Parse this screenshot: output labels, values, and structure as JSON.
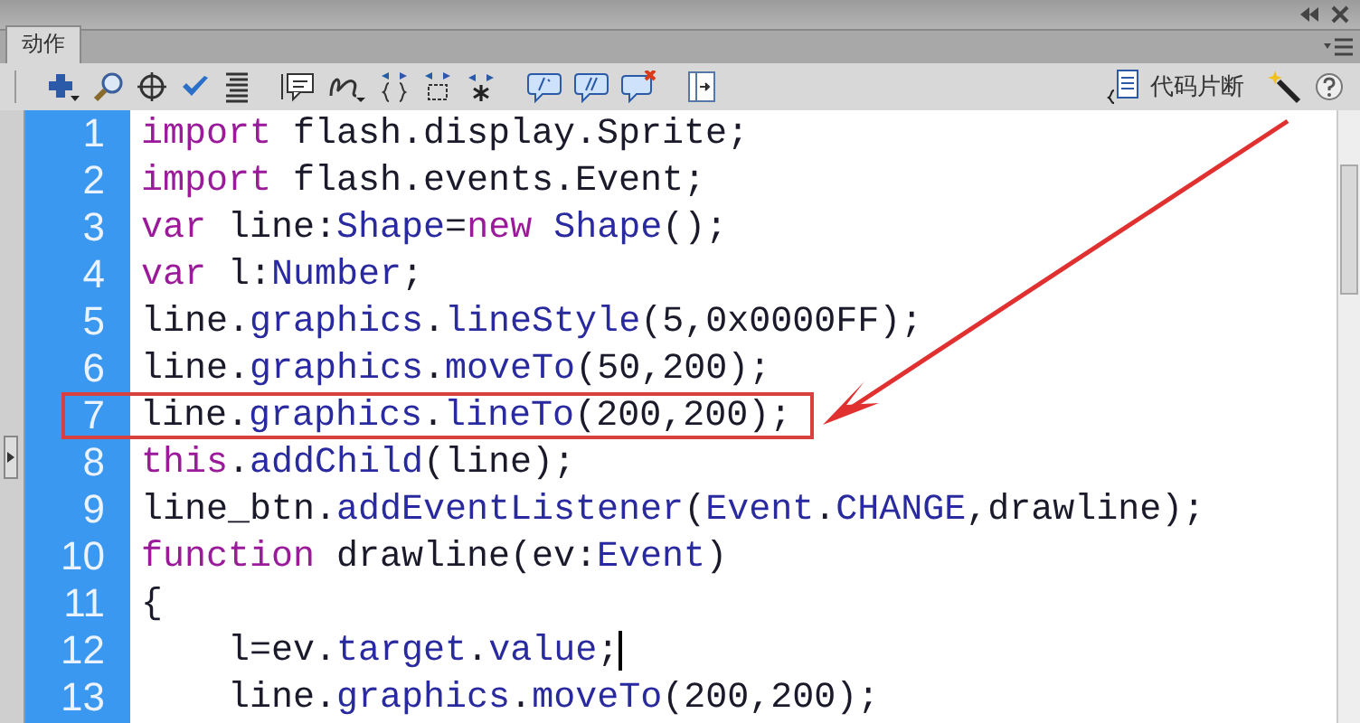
{
  "tabs": [
    {
      "label": "动作",
      "selected": true
    }
  ],
  "toolbar": {
    "snippets_label": "代码片断"
  },
  "lines": [
    {
      "number": "1",
      "highlighted": false,
      "cursor": false,
      "tokens": [
        {
          "kind": "kw",
          "text": "import"
        },
        {
          "kind": "plain",
          "text": " flash.display.Sprite;"
        }
      ]
    },
    {
      "number": "2",
      "highlighted": false,
      "cursor": false,
      "tokens": [
        {
          "kind": "kw",
          "text": "import"
        },
        {
          "kind": "plain",
          "text": " flash.events.Event;"
        }
      ]
    },
    {
      "number": "3",
      "highlighted": false,
      "cursor": false,
      "tokens": [
        {
          "kind": "kw",
          "text": "var"
        },
        {
          "kind": "plain",
          "text": " line:"
        },
        {
          "kind": "api",
          "text": "Shape"
        },
        {
          "kind": "plain",
          "text": "="
        },
        {
          "kind": "kw",
          "text": "new"
        },
        {
          "kind": "api",
          "text": " Shape"
        },
        {
          "kind": "plain",
          "text": "();"
        }
      ]
    },
    {
      "number": "4",
      "highlighted": false,
      "cursor": false,
      "tokens": [
        {
          "kind": "kw",
          "text": "var"
        },
        {
          "kind": "plain",
          "text": " l:"
        },
        {
          "kind": "api",
          "text": "Number"
        },
        {
          "kind": "plain",
          "text": ";"
        }
      ]
    },
    {
      "number": "5",
      "highlighted": false,
      "cursor": false,
      "tokens": [
        {
          "kind": "plain",
          "text": "line."
        },
        {
          "kind": "api",
          "text": "graphics"
        },
        {
          "kind": "plain",
          "text": "."
        },
        {
          "kind": "api",
          "text": "lineStyle"
        },
        {
          "kind": "plain",
          "text": "(5,0x0000FF);"
        }
      ]
    },
    {
      "number": "6",
      "highlighted": false,
      "cursor": false,
      "tokens": [
        {
          "kind": "plain",
          "text": "line."
        },
        {
          "kind": "api",
          "text": "graphics"
        },
        {
          "kind": "plain",
          "text": "."
        },
        {
          "kind": "api",
          "text": "moveTo"
        },
        {
          "kind": "plain",
          "text": "(50,200);"
        }
      ]
    },
    {
      "number": "7",
      "highlighted": true,
      "cursor": false,
      "tokens": [
        {
          "kind": "plain",
          "text": "line."
        },
        {
          "kind": "api",
          "text": "graphics"
        },
        {
          "kind": "plain",
          "text": "."
        },
        {
          "kind": "api",
          "text": "lineTo"
        },
        {
          "kind": "plain",
          "text": "(200,200);"
        }
      ]
    },
    {
      "number": "8",
      "highlighted": false,
      "cursor": false,
      "tokens": [
        {
          "kind": "kw",
          "text": "this"
        },
        {
          "kind": "plain",
          "text": "."
        },
        {
          "kind": "api",
          "text": "addChild"
        },
        {
          "kind": "plain",
          "text": "(line);"
        }
      ]
    },
    {
      "number": "9",
      "highlighted": false,
      "cursor": false,
      "tokens": [
        {
          "kind": "plain",
          "text": "line_btn."
        },
        {
          "kind": "api",
          "text": "addEventListener"
        },
        {
          "kind": "plain",
          "text": "("
        },
        {
          "kind": "api",
          "text": "Event"
        },
        {
          "kind": "plain",
          "text": "."
        },
        {
          "kind": "api",
          "text": "CHANGE"
        },
        {
          "kind": "plain",
          "text": ",drawline);"
        }
      ]
    },
    {
      "number": "10",
      "highlighted": false,
      "cursor": false,
      "tokens": [
        {
          "kind": "kw",
          "text": "function"
        },
        {
          "kind": "plain",
          "text": " drawline(ev:"
        },
        {
          "kind": "api",
          "text": "Event"
        },
        {
          "kind": "plain",
          "text": ")"
        }
      ]
    },
    {
      "number": "11",
      "highlighted": false,
      "cursor": false,
      "tokens": [
        {
          "kind": "plain",
          "text": "{"
        }
      ]
    },
    {
      "number": "12",
      "highlighted": false,
      "cursor": true,
      "tokens": [
        {
          "kind": "plain",
          "text": "    l=ev."
        },
        {
          "kind": "api",
          "text": "target"
        },
        {
          "kind": "plain",
          "text": "."
        },
        {
          "kind": "api",
          "text": "value"
        },
        {
          "kind": "plain",
          "text": ";"
        }
      ]
    },
    {
      "number": "13",
      "highlighted": false,
      "cursor": false,
      "tokens": [
        {
          "kind": "plain",
          "text": "    line."
        },
        {
          "kind": "api",
          "text": "graphics"
        },
        {
          "kind": "plain",
          "text": "."
        },
        {
          "kind": "api",
          "text": "moveTo"
        },
        {
          "kind": "plain",
          "text": "(200,200);"
        }
      ]
    }
  ]
}
